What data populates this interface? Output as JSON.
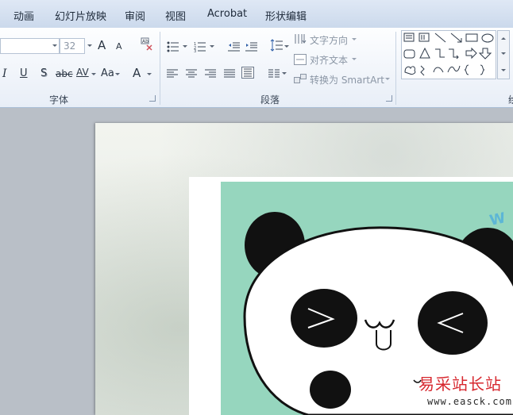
{
  "tabs": [
    "动画",
    "幻灯片放映",
    "审阅",
    "视图",
    "Acrobat",
    "形状编辑"
  ],
  "font_group": {
    "label": "字体",
    "font_size": "32",
    "grow_label": "A",
    "shrink_label": "A",
    "italic": "I",
    "underline": "U",
    "shadow": "S",
    "strike": "abc",
    "spacing": "AV",
    "change_case": "Aa",
    "font_color": "A"
  },
  "paragraph_group": {
    "label": "段落",
    "text_direction": "文字方向",
    "align_text": "对齐文本",
    "convert_smartart": "转换为 SmartArt"
  },
  "drawing_group": {
    "label_partial": "绘"
  },
  "watermark": {
    "site": "易采站长站",
    "url": "www.easck.com"
  },
  "colors": {
    "accent": "#96d6be",
    "watermark": "#d7282f"
  }
}
